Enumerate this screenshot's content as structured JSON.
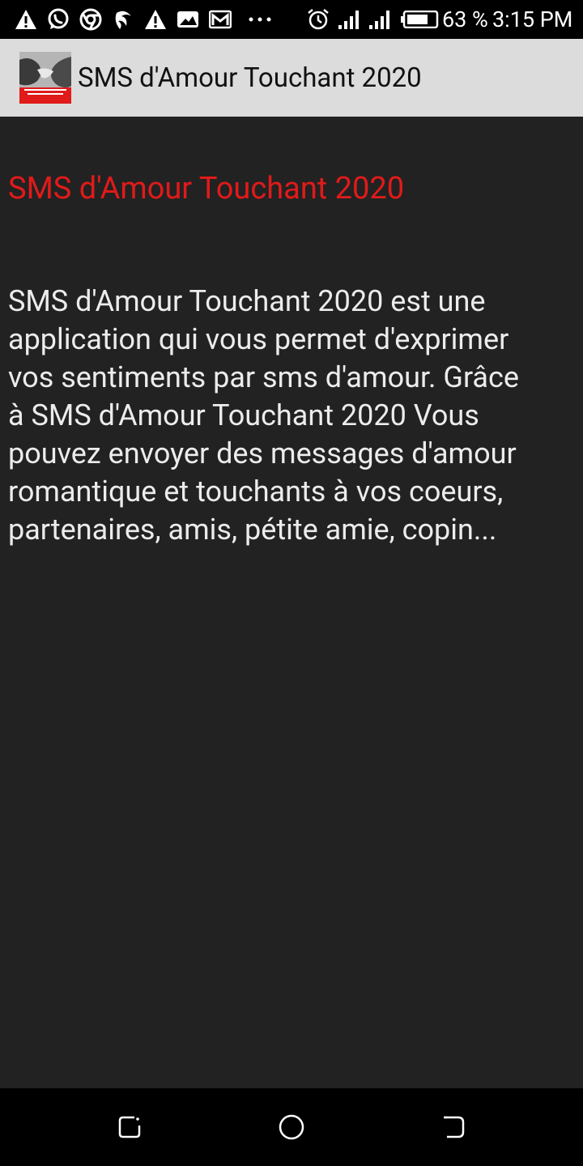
{
  "status_bar": {
    "battery_percent": "63 %",
    "time": "3:15 PM",
    "notification_icons": [
      "warning-icon",
      "whatsapp-icon",
      "chrome-icon",
      "app-icon",
      "warning-icon",
      "image-icon",
      "gmail-icon",
      "more-dots-icon"
    ],
    "system_icons": [
      "alarm-icon",
      "signal-icon",
      "signal-icon",
      "battery-icon"
    ]
  },
  "app_bar": {
    "title": "SMS d'Amour Touchant 2020"
  },
  "content": {
    "title": "SMS d'Amour Touchant 2020",
    "body": "SMS d'Amour Touchant 2020 est une\napplication qui vous permet d'exprimer\nvos sentiments par sms d'amour. Grâce\nà SMS d'Amour Touchant 2020 Vous\npouvez envoyer des messages d'amour\nromantique et touchants à vos coeurs,\npartenaires, amis, pétite amie, copin..."
  },
  "colors": {
    "title_red": "#e11a1a",
    "background": "#222222",
    "app_bar": "#dcdcdc"
  },
  "nav_bar": {
    "buttons": [
      "recent-apps-icon",
      "home-icon",
      "back-icon"
    ]
  }
}
